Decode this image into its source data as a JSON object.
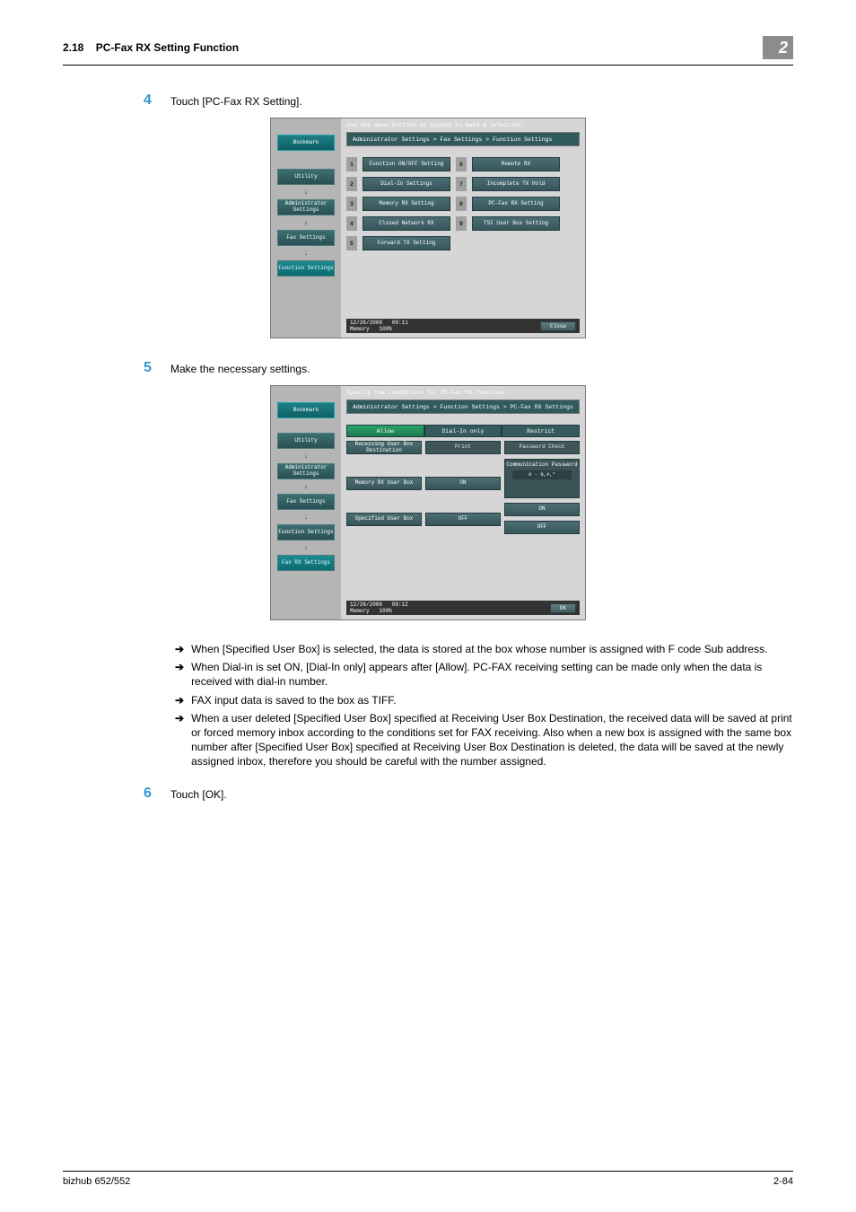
{
  "header": {
    "section": "2.18",
    "title": "PC-Fax RX Setting Function",
    "chapter": "2"
  },
  "step4": {
    "num": "4",
    "text": "Touch [PC-Fax RX Setting]."
  },
  "step5": {
    "num": "5",
    "text": "Make the necessary settings."
  },
  "step6": {
    "num": "6",
    "text": "Touch [OK]."
  },
  "bullets": {
    "b1": "When [Specified User Box] is selected, the data is stored at the box whose number is assigned with F code Sub address.",
    "b2": "When Dial-in is set ON, [Dial-In only] appears after [Allow]. PC-FAX receiving setting can be made only when the data is received with dial-in number.",
    "b3": "FAX input data is saved to the box as TIFF.",
    "b4": "When a user deleted [Specified User Box] specified at Receiving User Box Destination, the received data will be saved at print or forced memory inbox according to the conditions set for FAX receiving. Also when a new box is assigned with the same box number after [Specified User Box] specified at Receiving User Box Destination is deleted, the data will be saved at the newly assigned inbox, therefore you should be careful with the number assigned."
  },
  "footer": {
    "left": "bizhub 652/552",
    "right": "2-84"
  },
  "panel1": {
    "prompt": "Use the menu buttons or keypad to make a selection.",
    "breadcrumb": "Administrator Settings > Fax Settings > Function Settings",
    "nav": {
      "bookmark": "Bookmark",
      "utility": "Utility",
      "admin": "Administrator Settings",
      "fax": "Fax Settings",
      "func": "Function Settings"
    },
    "opts": {
      "n1": "1",
      "o1": "Function ON/OFF Setting",
      "n6": "6",
      "o6": "Remote RX",
      "n2": "2",
      "o2": "Dial-In Settings",
      "n7": "7",
      "o7": "Incomplete TX Hold",
      "n3": "3",
      "o3": "Memory RX Setting",
      "n8": "8",
      "o8": "PC-Fax RX Setting",
      "n4": "4",
      "o4": "Closed Network RX",
      "n9": "9",
      "o9": "TSI User Box Setting",
      "n5": "5",
      "o5": "Forward TX Setting"
    },
    "date": "12/26/2008",
    "time": "09:11",
    "mem": "Memory",
    "pct": "100%",
    "close": "Close"
  },
  "panel2": {
    "prompt": "Specify the conditions for PC-Fax RX function.",
    "breadcrumb": "Administrator Settings > Function Settings > PC-Fax RX Settings",
    "nav": {
      "bookmark": "Bookmark",
      "utility": "Utility",
      "admin": "Administrator Settings",
      "fax": "Fax Settings",
      "func": "Function Settings",
      "rx": "Fax RX Settings"
    },
    "tabs": {
      "allow": "Allow",
      "dialin": "Dial-In only",
      "restrict": "Restrict"
    },
    "c1": {
      "r1": "Receiving User Box Destination",
      "r2": "Memory RX User Box",
      "r3": "Specified User Box"
    },
    "c2": {
      "r1": "Print",
      "r2": "ON",
      "r3": "OFF"
    },
    "c3": {
      "r1": "Password Check",
      "r2label": "Communication Password",
      "r2val": "0 - 9,#,*",
      "on": "ON",
      "off": "OFF"
    },
    "date": "12/26/2008",
    "time": "09:12",
    "mem": "Memory",
    "pct": "100%",
    "ok": "OK"
  }
}
